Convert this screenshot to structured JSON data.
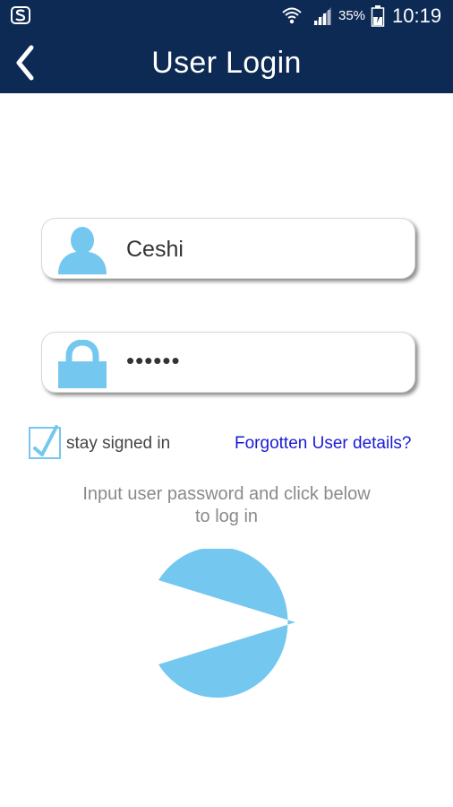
{
  "status_bar": {
    "app_icon": "s-app-icon",
    "wifi_icon": "wifi-icon",
    "signal_icon": "signal-icon",
    "battery_percent": "35%",
    "battery_icon": "battery-icon",
    "time": "10:19"
  },
  "header": {
    "back_icon": "chevron-left-icon",
    "title": "User Login"
  },
  "login_form": {
    "username_icon": "user-icon",
    "username_value": "Ceshi",
    "password_icon": "lock-icon",
    "password_value": "••••••",
    "stay_signed_in_checked": true,
    "stay_signed_in_label": "stay signed in",
    "forgot_link": "Forgotten User details?",
    "hint": "Input user password and click below to log in",
    "login_button_icon": "pacman-login-icon"
  },
  "colors": {
    "header_bg": "#0d2a55",
    "accent": "#74c7ef",
    "link": "#1a1ad6",
    "hint_text": "#8a8a8a"
  }
}
